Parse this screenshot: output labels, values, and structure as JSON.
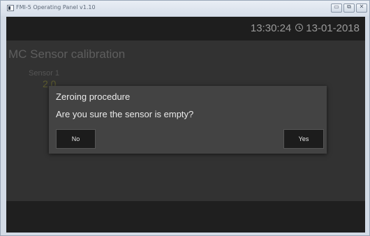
{
  "window": {
    "title": "FMI-5 Operating Panel v1.10"
  },
  "header": {
    "time": "13:30:24",
    "date": "13-01-2018"
  },
  "page": {
    "title": "MC Sensor calibration",
    "sensor_label": "Sensor 1",
    "sensor_value": "2.0"
  },
  "dialog": {
    "title": "Zeroing procedure",
    "message": "Are you sure the sensor is empty?",
    "no_label": "No",
    "yes_label": "Yes"
  },
  "window_controls": {
    "minimize": "▭",
    "maximize": "⧉",
    "close": "✕"
  },
  "icons": {
    "app": "app-icon",
    "clock": "clock-icon"
  }
}
